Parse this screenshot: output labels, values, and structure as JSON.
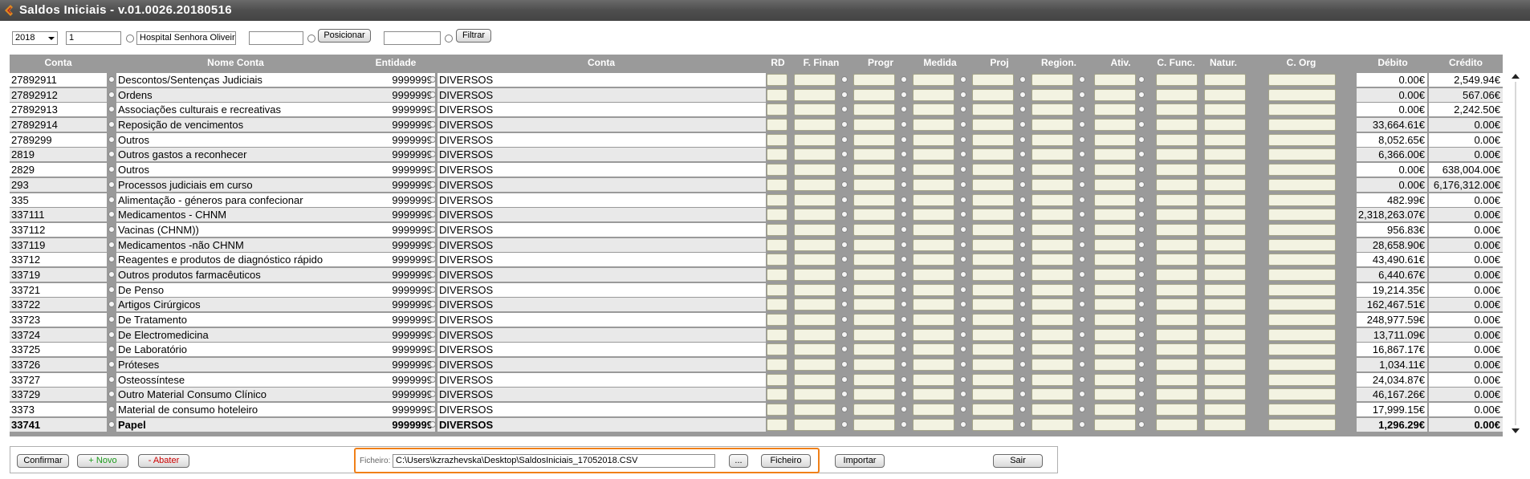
{
  "window": {
    "title": "Saldos Iniciais - v.01.0026.20180516"
  },
  "filter": {
    "year": "2018",
    "entity_code": "1",
    "entity_name": "Hospital Senhora Oliveira",
    "position_value": "",
    "position_button": "Posicionar",
    "filter_value": "",
    "filter_button": "Filtrar"
  },
  "columns": {
    "conta": "Conta",
    "nome_conta": "Nome Conta",
    "entidade": "Entidade",
    "conta2": "Conta",
    "rd": "RD",
    "f_finan": "F. Finan",
    "progr": "Progr",
    "medida": "Medida",
    "proj": "Proj",
    "region": "Region.",
    "ativ": "Ativ.",
    "c_func": "C. Func.",
    "natur": "Natur.",
    "c_org": "C. Org",
    "debito": "Débito",
    "credito": "Crédito"
  },
  "rows": [
    {
      "conta": "27892911",
      "nome": "Descontos/Sentenças Judiciais",
      "entidade": "9999999",
      "conta_nome": "DIVERSOS",
      "debito": "0.00€",
      "credito": "2,549.94€"
    },
    {
      "conta": "27892912",
      "nome": "Ordens",
      "entidade": "9999999",
      "conta_nome": "DIVERSOS",
      "debito": "0.00€",
      "credito": "567.06€"
    },
    {
      "conta": "27892913",
      "nome": "Associações culturais e recreativas",
      "entidade": "9999999",
      "conta_nome": "DIVERSOS",
      "debito": "0.00€",
      "credito": "2,242.50€"
    },
    {
      "conta": "27892914",
      "nome": "Reposição de vencimentos",
      "entidade": "9999999",
      "conta_nome": "DIVERSOS",
      "debito": "33,664.61€",
      "credito": "0.00€"
    },
    {
      "conta": "2789299",
      "nome": "Outros",
      "entidade": "9999999",
      "conta_nome": "DIVERSOS",
      "debito": "8,052.65€",
      "credito": "0.00€"
    },
    {
      "conta": "2819",
      "nome": "Outros gastos a reconhecer",
      "entidade": "9999999",
      "conta_nome": "DIVERSOS",
      "debito": "6,366.00€",
      "credito": "0.00€"
    },
    {
      "conta": "2829",
      "nome": "Outros",
      "entidade": "9999999",
      "conta_nome": "DIVERSOS",
      "debito": "0.00€",
      "credito": "638,004.00€"
    },
    {
      "conta": "293",
      "nome": "Processos judiciais em curso",
      "entidade": "9999999",
      "conta_nome": "DIVERSOS",
      "debito": "0.00€",
      "credito": "6,176,312.00€"
    },
    {
      "conta": "335",
      "nome": "Alimentação - géneros para confecionar",
      "entidade": "9999999",
      "conta_nome": "DIVERSOS",
      "debito": "482.99€",
      "credito": "0.00€"
    },
    {
      "conta": "337111",
      "nome": "Medicamentos - CHNM",
      "entidade": "9999999",
      "conta_nome": "DIVERSOS",
      "debito": "2,318,263.07€",
      "credito": "0.00€"
    },
    {
      "conta": "337112",
      "nome": "Vacinas (CHNM))",
      "entidade": "9999999",
      "conta_nome": "DIVERSOS",
      "debito": "956.83€",
      "credito": "0.00€"
    },
    {
      "conta": "337119",
      "nome": "Medicamentos -não CHNM",
      "entidade": "9999999",
      "conta_nome": "DIVERSOS",
      "debito": "28,658.90€",
      "credito": "0.00€"
    },
    {
      "conta": "33712",
      "nome": "Reagentes e produtos de diagnóstico rápido",
      "entidade": "9999999",
      "conta_nome": "DIVERSOS",
      "debito": "43,490.61€",
      "credito": "0.00€"
    },
    {
      "conta": "33719",
      "nome": "Outros produtos farmacêuticos",
      "entidade": "9999999",
      "conta_nome": "DIVERSOS",
      "debito": "6,440.67€",
      "credito": "0.00€"
    },
    {
      "conta": "33721",
      "nome": "De Penso",
      "entidade": "9999999",
      "conta_nome": "DIVERSOS",
      "debito": "19,214.35€",
      "credito": "0.00€"
    },
    {
      "conta": "33722",
      "nome": "Artigos Cirúrgicos",
      "entidade": "9999999",
      "conta_nome": "DIVERSOS",
      "debito": "162,467.51€",
      "credito": "0.00€"
    },
    {
      "conta": "33723",
      "nome": "De Tratamento",
      "entidade": "9999999",
      "conta_nome": "DIVERSOS",
      "debito": "248,977.59€",
      "credito": "0.00€"
    },
    {
      "conta": "33724",
      "nome": "De Electromedicina",
      "entidade": "9999999",
      "conta_nome": "DIVERSOS",
      "debito": "13,711.09€",
      "credito": "0.00€"
    },
    {
      "conta": "33725",
      "nome": "De Laboratório",
      "entidade": "9999999",
      "conta_nome": "DIVERSOS",
      "debito": "16,867.17€",
      "credito": "0.00€"
    },
    {
      "conta": "33726",
      "nome": "Próteses",
      "entidade": "9999999",
      "conta_nome": "DIVERSOS",
      "debito": "1,034.11€",
      "credito": "0.00€"
    },
    {
      "conta": "33727",
      "nome": "Osteossíntese",
      "entidade": "9999999",
      "conta_nome": "DIVERSOS",
      "debito": "24,034.87€",
      "credito": "0.00€"
    },
    {
      "conta": "33729",
      "nome": "Outro Material Consumo Clínico",
      "entidade": "9999999",
      "conta_nome": "DIVERSOS",
      "debito": "46,167.26€",
      "credito": "0.00€"
    },
    {
      "conta": "3373",
      "nome": "Material de consumo hoteleiro",
      "entidade": "9999999",
      "conta_nome": "DIVERSOS",
      "debito": "17,999.15€",
      "credito": "0.00€"
    },
    {
      "conta": "33741",
      "nome": "Papel",
      "entidade": "9999999",
      "conta_nome": "DIVERSOS",
      "debito": "1,296.29€",
      "credito": "0.00€",
      "selected": true
    }
  ],
  "footer": {
    "confirm": "Confirmar",
    "new": "+ Novo",
    "delete": "- Abater",
    "file_label": "Ficheiro:",
    "file_path": "C:\\Users\\kzrazhevska\\Desktop\\SaldosIniciais_17052018.CSV",
    "browse": "...",
    "file_button": "Ficheiro",
    "import": "Importar",
    "exit": "Sair"
  },
  "colors": {
    "titlebar": "#4e4e4e",
    "grid_header": "#9a9a9a",
    "highlight": "#f08018",
    "new_text": "#1a9a1a",
    "delete_text": "#cc0000"
  },
  "icons": {
    "app": "app-logo-icon",
    "scroll_up": "arrow-up-icon",
    "scroll_down": "arrow-down-icon"
  }
}
